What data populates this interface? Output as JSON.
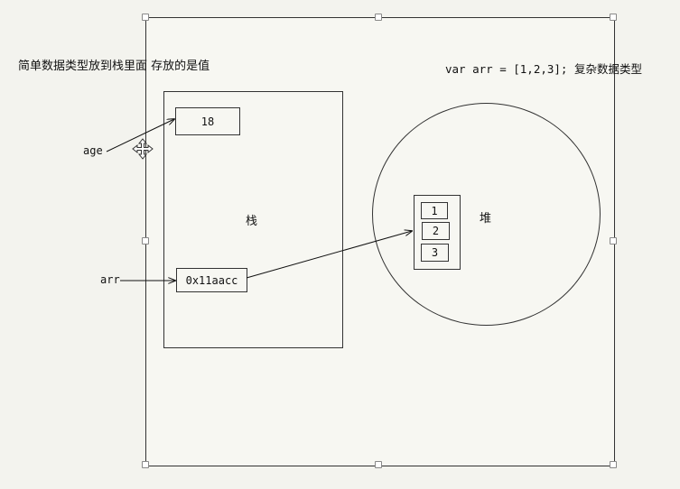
{
  "title_left": "简单数据类型放到栈里面 存放的是值",
  "title_right": "var arr = [1,2,3]; 复杂数据类型",
  "stack": {
    "label": "栈",
    "age_value": "18",
    "arr_value": "0x11aacc"
  },
  "heap": {
    "label": "堆",
    "items": [
      "1",
      "2",
      "3"
    ]
  },
  "vars": {
    "age": "age",
    "arr": "arr"
  }
}
